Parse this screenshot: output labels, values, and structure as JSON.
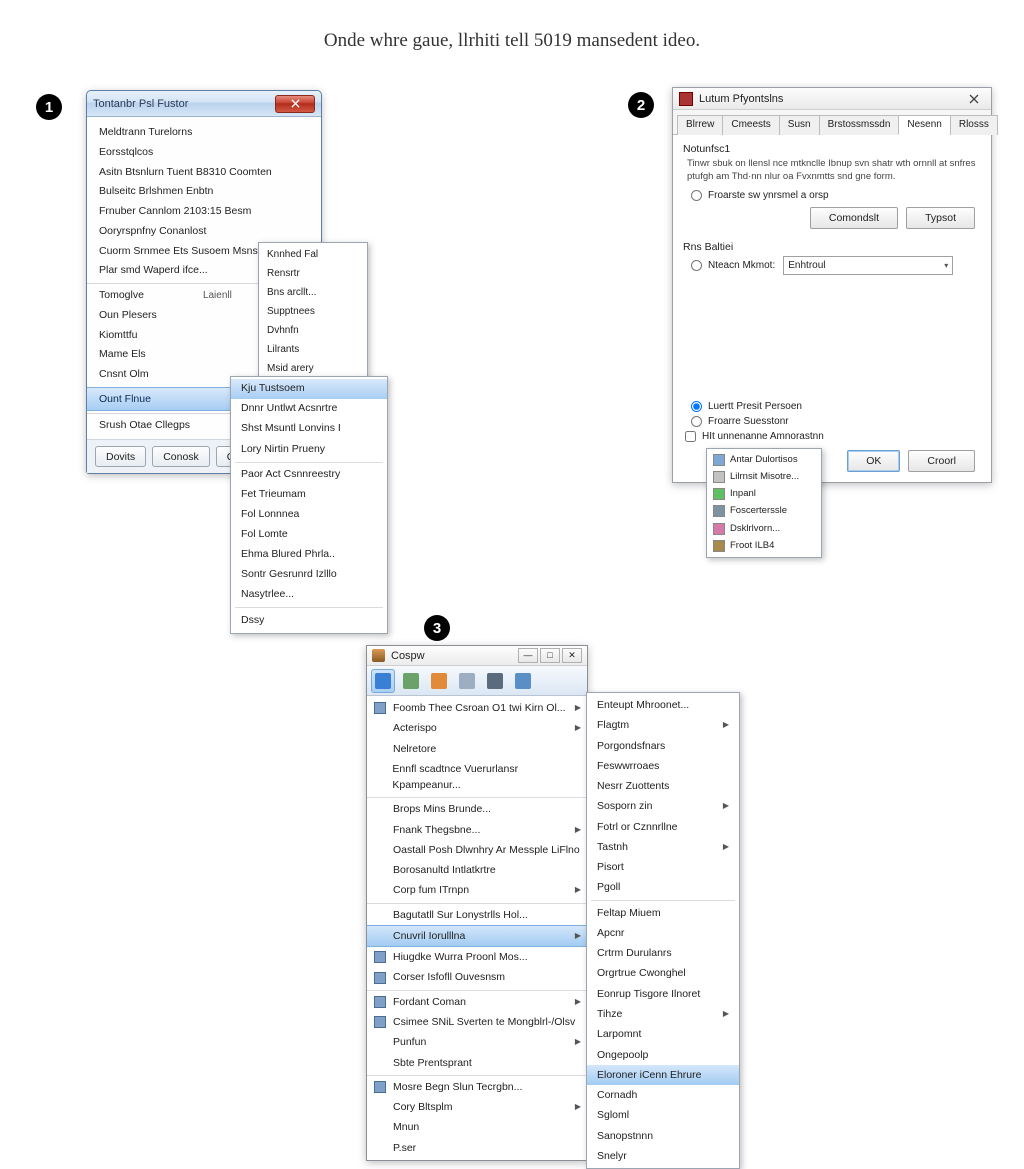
{
  "page_title": "Onde whre gaue, llrhiti tell 5019 mansedent ideo.",
  "badges": {
    "b1": "1",
    "b2": "2",
    "b3": "3"
  },
  "panel1": {
    "title": "Tontanbr Psl Fustor",
    "items": [
      {
        "label": "Meldtrann Turelorns"
      },
      {
        "label": "Eorsstqlcos"
      },
      {
        "label": "Asitn Btsnlurn Tuent B8310 Coomten"
      },
      {
        "label": "Bulseitc Brlshmen Enbtn"
      },
      {
        "label": "Frnuber Cannlom 2103:15 Besm"
      },
      {
        "label": "Ooryrspnfny Conanlost"
      },
      {
        "label": "Cuorm Srnmee Ets Susoem Msnstl o"
      },
      {
        "label": "Plar smd Waperd ifce..."
      }
    ],
    "items2": [
      {
        "label": "Tomoglve",
        "right": "Laienll",
        "arrow": true,
        "sep": true
      },
      {
        "label": "Oun Plesers",
        "arrow": true
      },
      {
        "label": "Kiomttfu"
      },
      {
        "label": "Mame Els",
        "arrow": true
      },
      {
        "label": "Cnsnt Olm",
        "arrow": true
      }
    ],
    "hl": {
      "label": "Ount Flnue",
      "arrow": true
    },
    "items3": [
      {
        "label": "Srush Otae Cllegps",
        "arrow": true
      }
    ],
    "buttons": [
      "Dovits",
      "Conosk",
      "Cvnuel"
    ],
    "sub_a": [
      "Knnhed Fal",
      "Rensrtr",
      "Bns arcllt...",
      "Supptnees",
      "Dvhnfn",
      "Lilrants",
      "Msid arery"
    ],
    "sub_b": [
      {
        "label": "Kju Tustsoem",
        "hl": true
      },
      {
        "label": "Dnnr Untlwt Acsnrtre"
      },
      {
        "label": "Shst Msuntl Lonvins I"
      },
      {
        "label": "Lory Nirtin Prueny"
      },
      {
        "sep": true
      },
      {
        "label": "Paor Act Csnnreestry"
      },
      {
        "label": "Fet Trieumam"
      },
      {
        "label": "Fol Lonnnea"
      },
      {
        "label": "Fol Lomte"
      },
      {
        "label": "Ehma Blured Phrla.."
      },
      {
        "label": "Sontr Gesrunrd Izlllo"
      },
      {
        "label": "Nasytrlee..."
      },
      {
        "sep": true
      },
      {
        "label": "Dssy"
      }
    ]
  },
  "panel2": {
    "title": "Lutum Pfyontslns",
    "tabs": [
      "Blrrew",
      "Cmeests",
      "Susn",
      "Brstossmssdn",
      "Nesenn",
      "Rlosss"
    ],
    "active_tab": 4,
    "section1_title": "Notunfsc1",
    "section1_desc": "Tinwr sbuk on llensl nce mtknclle Ibnup svn shatr wth ornnll at snfres ptufgh am Thd·nn nlur oa Fvxnmtts snd gne form.",
    "radio1": "Froarste sw ynrsmel a orsp",
    "btn_conw": "Comondslt",
    "btn_tps": "Typsot",
    "section2_title": "Rns Baltiei",
    "radio2": "Nteacn Mkmot:",
    "select_val": "Enhtroul",
    "radio3": "Luertt Presit Persoen",
    "radio4": "Froarre Suesstonr",
    "check_label": "HIt unnenanne Amnorastnn",
    "ok": "OK",
    "cancel": "Croorl",
    "menu": [
      {
        "color": "#7fa7d6",
        "label": "Antar Dulortisos"
      },
      {
        "color": "#c2c2c2",
        "label": "Lilrnsit Misotre..."
      },
      {
        "color": "#5fbf63",
        "label": "Inpanl"
      },
      {
        "color": "#7d93a2",
        "label": "Foscerterssle"
      },
      {
        "color": "#d77aa8",
        "label": "Dsklrlvorn..."
      },
      {
        "color": "#a88a4d",
        "label": "Froot ILB4"
      }
    ]
  },
  "panel3": {
    "title": "Cospw",
    "toolbar_icons": [
      {
        "name": "blue-tab-icon",
        "color": "#3a7fd6",
        "active": true
      },
      {
        "name": "globe-icon",
        "color": "#6aa26a"
      },
      {
        "name": "orange-doc-icon",
        "color": "#e08a3a"
      },
      {
        "name": "light-gear-icon",
        "color": "#9cafc2"
      },
      {
        "name": "dark-save-icon",
        "color": "#5a6b7d"
      },
      {
        "name": "blue-help-icon",
        "color": "#5a8fc6"
      }
    ],
    "items": [
      {
        "icon": true,
        "label": "Foomb Thee Csroan O1 twi Kirn Ol...",
        "arrow": true
      },
      {
        "label": "Acterispo",
        "arrow": true
      },
      {
        "label": "Nelretore"
      },
      {
        "label": "Ennfl scadtnce Vuerurlansr Kpampeanur..."
      },
      {
        "label": "Brops Mins Brunde...",
        "sep": true
      },
      {
        "label": "Fnank Thegsbne...",
        "arrow": true
      },
      {
        "label": "Oastall Posh Dlwnhry Ar Messple LiFlno"
      },
      {
        "label": "Borosanultd Intlatkrtre"
      },
      {
        "label": "Corp fum ITrnpn",
        "arrow": true
      },
      {
        "label": "Bagutatll Sur Lonystrlls Hol...",
        "sep": true
      },
      {
        "label": "Cnuvril Iorulllna",
        "arrow": true,
        "hl": true
      },
      {
        "icon": true,
        "label": "Hiugdke Wurra Proonl Mos..."
      },
      {
        "icon": true,
        "label": "Corser Isfofll Ouvesnsm"
      },
      {
        "icon": true,
        "label": "Fordant Coman",
        "arrow": true,
        "sep": true
      },
      {
        "icon": true,
        "label": "Csimee SNiL Sverten te Mongblrl-/Olsv"
      },
      {
        "label": "Punfun",
        "arrow": true
      },
      {
        "label": "Sbte Prentsprant"
      },
      {
        "icon": true,
        "label": "Mosre Begn Slun Tecrgbn...",
        "sep": true
      },
      {
        "label": "Cory Bltsplm",
        "arrow": true
      },
      {
        "label": "Mnun"
      },
      {
        "label": "P.ser"
      }
    ],
    "sub": [
      {
        "label": "Enteupt Mhroonet..."
      },
      {
        "label": "Flagtm",
        "arrow": true
      },
      {
        "label": "Porgondsfnars"
      },
      {
        "label": "Feswwrroaes"
      },
      {
        "label": "Nesrr Zuottents"
      },
      {
        "label": "Sosporn zin",
        "arrow": true
      },
      {
        "label": "Fotrl or Cznnrllne"
      },
      {
        "label": "Tastnh",
        "arrow": true
      },
      {
        "label": "Pisort"
      },
      {
        "label": "Pgoll"
      },
      {
        "sep": true
      },
      {
        "label": "Feltap Miuem"
      },
      {
        "label": "Apcnr"
      },
      {
        "label": "Crtrm Durulanrs"
      },
      {
        "label": "Orgrtrue Cwonghel"
      },
      {
        "label": "Eonrup Tisgore Ilnoret"
      },
      {
        "label": "Tihze",
        "arrow": true
      },
      {
        "label": "Larpomnt"
      },
      {
        "label": "Ongepoolp"
      },
      {
        "label": "Eloroner iCenn Ehrure",
        "hl": true
      },
      {
        "label": "Cornadh"
      },
      {
        "label": "Sgloml"
      },
      {
        "label": "Sanopstnnn"
      },
      {
        "label": "Snelyr"
      }
    ]
  }
}
